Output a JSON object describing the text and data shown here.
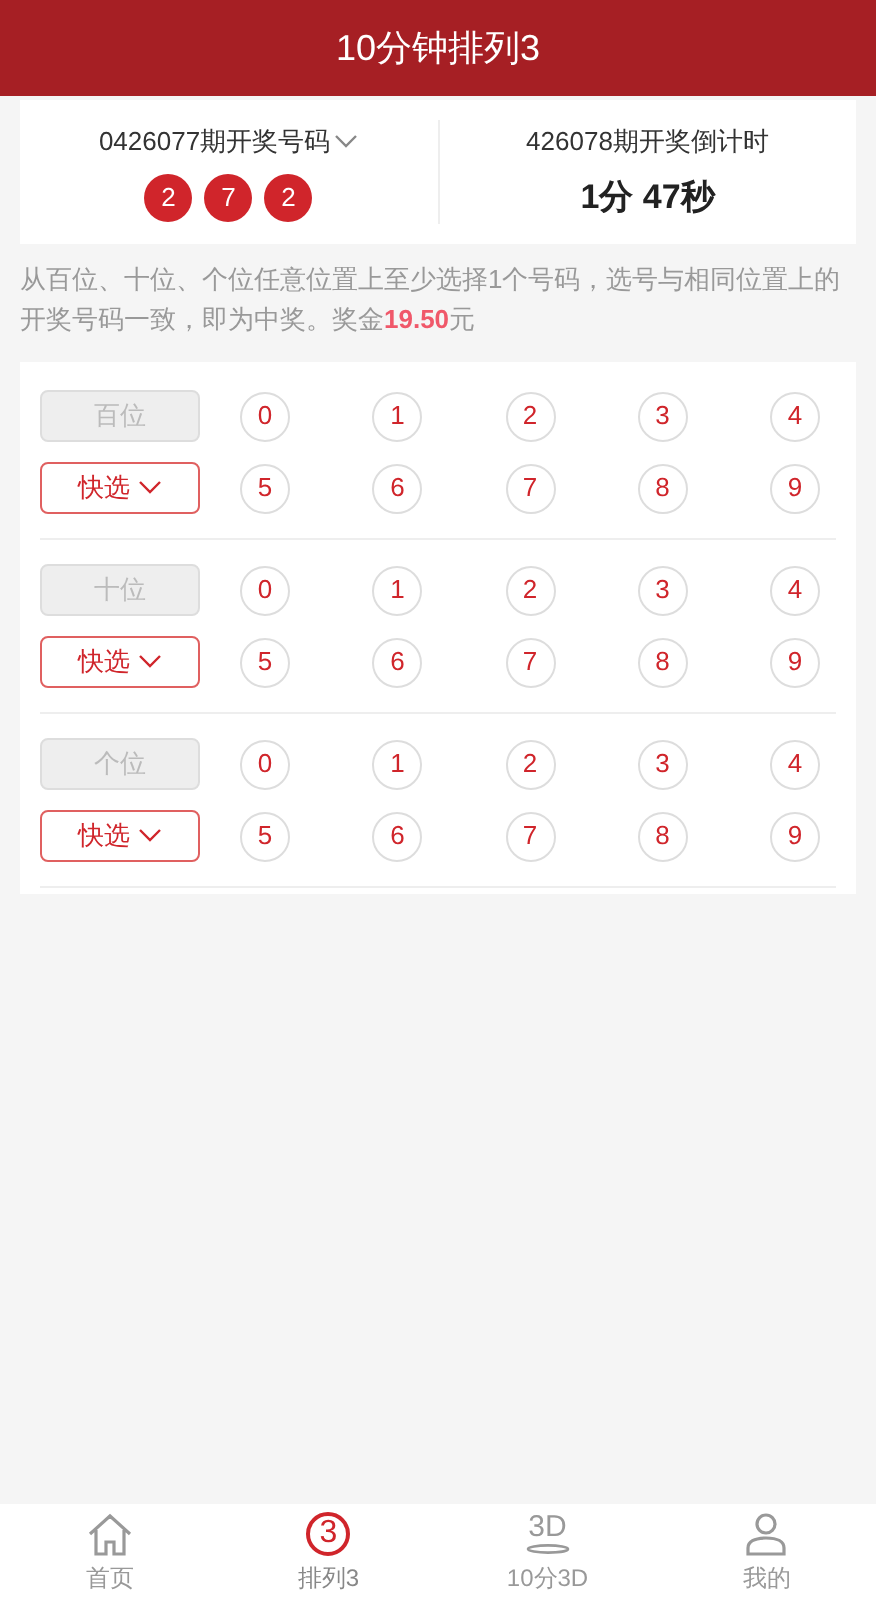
{
  "header": {
    "title": "10分钟排列3"
  },
  "draw": {
    "last_issue": "0426077期开奖号码",
    "balls": [
      "2",
      "7",
      "2"
    ],
    "next_issue": "426078期开奖倒计时",
    "countdown": "1分 47秒"
  },
  "rules": {
    "text": "从百位、十位、个位任意位置上至少选择1个号码，选号与相同位置上的开奖号码一致，即为中奖。奖金**19.50**元"
  },
  "positions": [
    {
      "label": "百位",
      "quick": "快选",
      "numbers": [
        {
          "n": "0",
          "selected": false
        },
        {
          "n": "1",
          "selected": false
        },
        {
          "n": "2",
          "selected": false
        },
        {
          "n": "3",
          "selected": false
        },
        {
          "n": "4",
          "selected": false
        },
        {
          "n": "5",
          "selected": false
        },
        {
          "n": "6",
          "selected": false
        },
        {
          "n": "7",
          "selected": false
        },
        {
          "n": "8",
          "selected": false
        },
        {
          "n": "9",
          "selected": false
        }
      ]
    },
    {
      "label": "十位",
      "quick": "快选",
      "numbers": [
        {
          "n": "0",
          "selected": false
        },
        {
          "n": "1",
          "selected": false
        },
        {
          "n": "2",
          "selected": false
        },
        {
          "n": "3",
          "selected": false
        },
        {
          "n": "4",
          "selected": false
        },
        {
          "n": "5",
          "selected": false
        },
        {
          "n": "6",
          "selected": false
        },
        {
          "n": "7",
          "selected": false
        },
        {
          "n": "8",
          "selected": false
        },
        {
          "n": "9",
          "selected": false
        }
      ]
    },
    {
      "label": "个位",
      "quick": "快选",
      "numbers": [
        {
          "n": "0",
          "selected": false
        },
        {
          "n": "1",
          "selected": false
        },
        {
          "n": "2",
          "selected": false
        },
        {
          "n": "3",
          "selected": false
        },
        {
          "n": "4",
          "selected": false
        },
        {
          "n": "5",
          "selected": false
        },
        {
          "n": "6",
          "selected": false
        },
        {
          "n": "7",
          "selected": false
        },
        {
          "n": "8",
          "selected": false
        },
        {
          "n": "9",
          "selected": false
        }
      ]
    }
  ],
  "tabbar": [
    {
      "kind": "home",
      "label": "首页",
      "selected": false
    },
    {
      "kind": "circled",
      "icon_label": "3",
      "label": "排列3",
      "selected": true
    },
    {
      "kind": "three_d",
      "icon_label": "3D",
      "label": "10分3D",
      "selected": false
    },
    {
      "kind": "user",
      "label": "我的",
      "selected": false
    }
  ]
}
